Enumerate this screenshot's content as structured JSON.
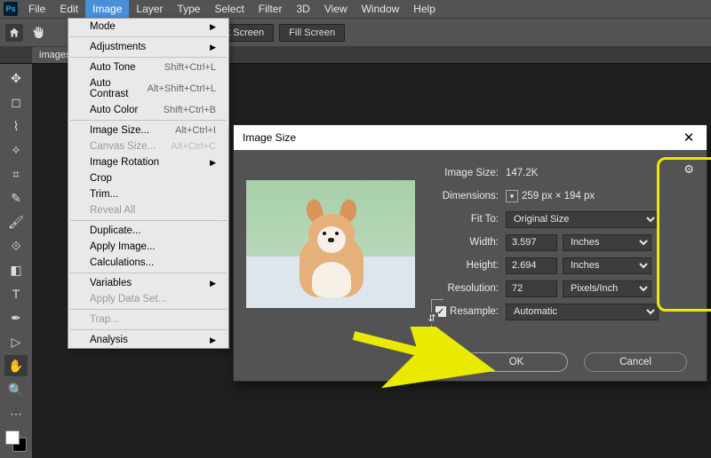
{
  "menubar": {
    "items": [
      "File",
      "Edit",
      "Image",
      "Layer",
      "Type",
      "Select",
      "Filter",
      "3D",
      "View",
      "Window",
      "Help"
    ],
    "active": "Image"
  },
  "optbar": {
    "fit_screen": "Fit Screen",
    "fill_screen": "Fill Screen"
  },
  "doctab": "images.",
  "dropdown": {
    "mode": "Mode",
    "adjustments": "Adjustments",
    "auto_tone": "Auto Tone",
    "auto_tone_sc": "Shift+Ctrl+L",
    "auto_contrast": "Auto Contrast",
    "auto_contrast_sc": "Alt+Shift+Ctrl+L",
    "auto_color": "Auto Color",
    "auto_color_sc": "Shift+Ctrl+B",
    "image_size": "Image Size...",
    "image_size_sc": "Alt+Ctrl+I",
    "canvas_size": "Canvas Size...",
    "canvas_size_sc": "Alt+Ctrl+C",
    "image_rotation": "Image Rotation",
    "crop": "Crop",
    "trim": "Trim...",
    "reveal_all": "Reveal All",
    "duplicate": "Duplicate...",
    "apply_image": "Apply Image...",
    "calculations": "Calculations...",
    "variables": "Variables",
    "apply_data_set": "Apply Data Set...",
    "trap": "Trap...",
    "analysis": "Analysis"
  },
  "dialog": {
    "title": "Image Size",
    "image_size_label": "Image Size:",
    "image_size_value": "147.2K",
    "dimensions_label": "Dimensions:",
    "dimensions_value": "259 px  ×  194 px",
    "fit_to_label": "Fit To:",
    "fit_to_value": "Original Size",
    "width_label": "Width:",
    "width_value": "3.597",
    "width_unit": "Inches",
    "height_label": "Height:",
    "height_value": "2.694",
    "height_unit": "Inches",
    "resolution_label": "Resolution:",
    "resolution_value": "72",
    "resolution_unit": "Pixels/Inch",
    "resample_label": "Resample:",
    "resample_value": "Automatic",
    "ok": "OK",
    "cancel": "Cancel"
  }
}
